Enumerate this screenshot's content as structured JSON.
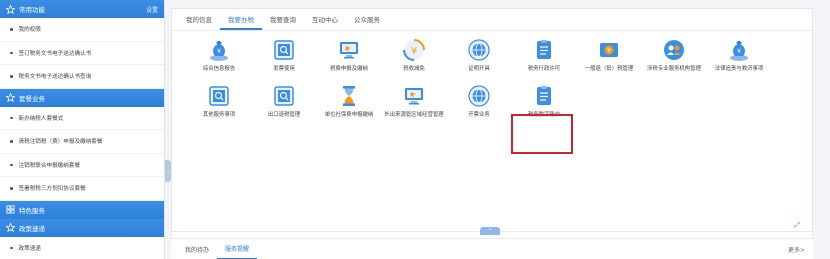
{
  "sidebar": {
    "sections": [
      {
        "title": "常用功能",
        "extra": "设置",
        "icon": "star-icon",
        "items": [
          "我的权限",
          "签订税务文书电子送达确认书",
          "税务文书电子送达确认书查询"
        ]
      },
      {
        "title": "套餐业务",
        "icon": "star-icon",
        "items": [
          "新办纳税人套餐式",
          "清税注销税（费）申报及缴纳套餐",
          "注销税联合申报缴纳套餐",
          "签署税税三方划扣协议套餐"
        ]
      },
      {
        "title": "特色服务",
        "icon": "grid-icon",
        "items": []
      },
      {
        "title": "政策速递",
        "icon": "star-icon",
        "items": [
          "政策速递"
        ]
      }
    ]
  },
  "tabs": [
    "我的信息",
    "我要办税",
    "我要查询",
    "互动中心",
    "公众服务"
  ],
  "active_tab": "我要办税",
  "tiles": [
    {
      "label": "综合信息报告",
      "icon": "money-bag-icon"
    },
    {
      "label": "发票使用",
      "icon": "invoice-search-icon"
    },
    {
      "label": "税费申报及缴纳",
      "icon": "monitor-icon"
    },
    {
      "label": "税收减免",
      "icon": "yuan-cycle-icon"
    },
    {
      "label": "证明开具",
      "icon": "globe-stamp-icon"
    },
    {
      "label": "税务行政许可",
      "icon": "document-icon"
    },
    {
      "label": "一般退（抵）税管理",
      "icon": "yuan-card-icon"
    },
    {
      "label": "涉税专业服务机构管理",
      "icon": "people-icon"
    },
    {
      "label": "法律追责与救济事项",
      "icon": "money-bag-icon"
    },
    {
      "label": "其他服务事项",
      "icon": "invoice-search-icon"
    },
    {
      "label": "出口退税管理",
      "icon": "invoice-search-icon"
    },
    {
      "label": "单位社保费申报缴纳",
      "icon": "hourglass-icon"
    },
    {
      "label": "外出来源管区域经营管理",
      "icon": "monitor-icon"
    },
    {
      "label": "开票业务",
      "icon": "globe-stamp-icon"
    },
    {
      "label": "税务数字账户",
      "icon": "document-icon"
    }
  ],
  "bottom_tabs": [
    "我的待办",
    "服务提醒"
  ],
  "active_bottom_tab": "服务提醒",
  "more_label": "更多>",
  "colors": {
    "primary": "#2f7fd8",
    "highlight": "#c8262c"
  }
}
